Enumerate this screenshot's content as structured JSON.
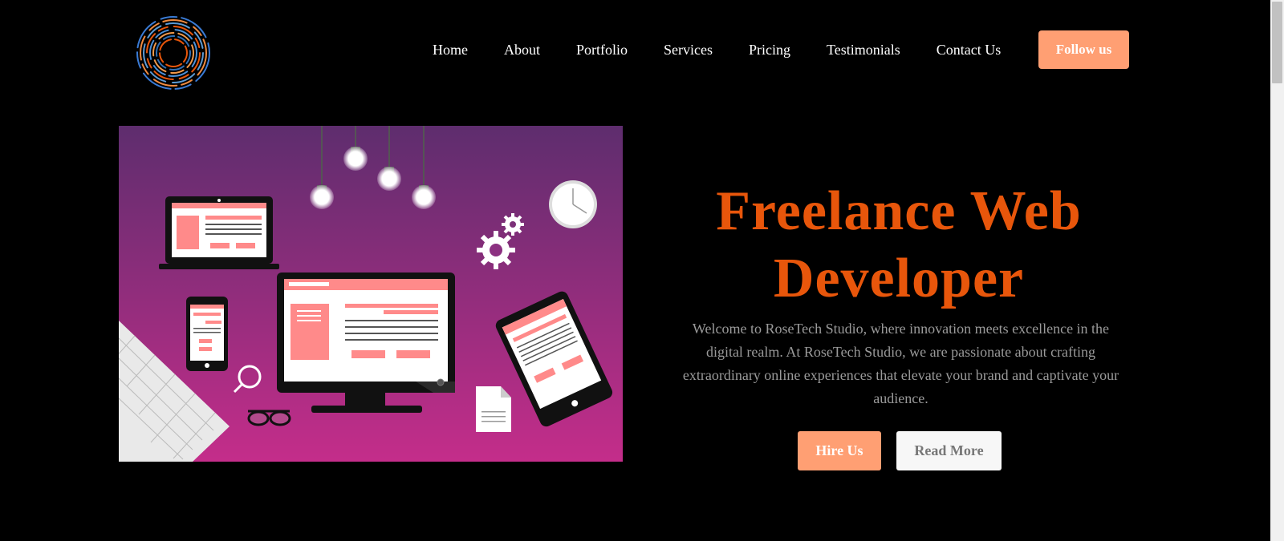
{
  "header": {
    "logo_icon": "concentric-circles-logo-icon",
    "nav": [
      {
        "label": "Home"
      },
      {
        "label": "About"
      },
      {
        "label": "Portfolio"
      },
      {
        "label": "Services"
      },
      {
        "label": "Pricing"
      },
      {
        "label": "Testimonials"
      },
      {
        "label": "Contact Us"
      }
    ],
    "follow_label": "Follow us"
  },
  "hero": {
    "title_line1": "Freelance Web",
    "title_line2": "Developer",
    "description": "Welcome to RoseTech Studio, where innovation meets excellence in the digital realm. At RoseTech Studio, we are passionate about crafting extraordinary online experiences that elevate your brand and captivate your audience.",
    "hire_label": "Hire Us",
    "read_label": "Read More"
  },
  "colors": {
    "background": "#000000",
    "accent": "#ff9f73",
    "title": "#e8560b",
    "description": "#9a9a9a",
    "illustration_top": "#5e2d6e",
    "illustration_bottom": "#c42d8a"
  }
}
